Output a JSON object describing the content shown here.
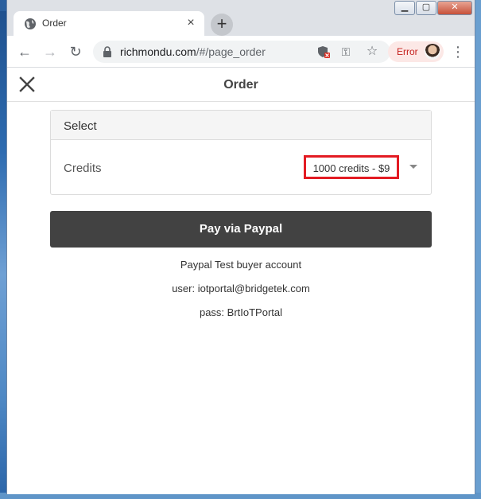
{
  "browser": {
    "tab": {
      "title": "Order",
      "close_glyph": "×",
      "icon": "globe-icon"
    },
    "new_tab_glyph": "+",
    "window_controls": {
      "minimize": "▁",
      "maximize": "▢",
      "close": "✕"
    },
    "nav": {
      "back_glyph": "←",
      "forward_glyph": "→",
      "reload_glyph": "↻"
    },
    "address": {
      "host": "richmondu.com",
      "path": "/#/page_order"
    },
    "omnibox_icons": {
      "shield": "shield-blocked-icon",
      "key_glyph": "⚿",
      "star_glyph": "☆"
    },
    "profile": {
      "error_label": "Error"
    },
    "menu_glyph": "⋮"
  },
  "page": {
    "title": "Order",
    "close_icon": "close-icon",
    "select_section": {
      "header": "Select",
      "field_label": "Credits",
      "selected_value": "1000 credits - $9",
      "highlight_color": "#e31b23"
    },
    "pay_button_label": "Pay via Paypal",
    "info": [
      "Paypal Test buyer account",
      "user: iotportal@bridgetek.com",
      "pass: BrtIoTPortal"
    ]
  },
  "colors": {
    "pay_button": "#424242",
    "error_chip_bg": "#fce8e6",
    "error_text": "#c5221f"
  }
}
